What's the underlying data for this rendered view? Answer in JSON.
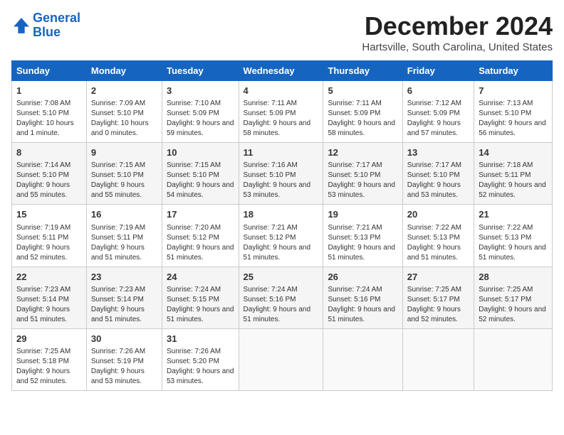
{
  "logo": {
    "line1": "General",
    "line2": "Blue"
  },
  "title": "December 2024",
  "subtitle": "Hartsville, South Carolina, United States",
  "days_of_week": [
    "Sunday",
    "Monday",
    "Tuesday",
    "Wednesday",
    "Thursday",
    "Friday",
    "Saturday"
  ],
  "weeks": [
    [
      {
        "day": "1",
        "sunrise": "7:08 AM",
        "sunset": "5:10 PM",
        "daylight": "10 hours and 1 minute."
      },
      {
        "day": "2",
        "sunrise": "7:09 AM",
        "sunset": "5:10 PM",
        "daylight": "10 hours and 0 minutes."
      },
      {
        "day": "3",
        "sunrise": "7:10 AM",
        "sunset": "5:09 PM",
        "daylight": "9 hours and 59 minutes."
      },
      {
        "day": "4",
        "sunrise": "7:11 AM",
        "sunset": "5:09 PM",
        "daylight": "9 hours and 58 minutes."
      },
      {
        "day": "5",
        "sunrise": "7:11 AM",
        "sunset": "5:09 PM",
        "daylight": "9 hours and 58 minutes."
      },
      {
        "day": "6",
        "sunrise": "7:12 AM",
        "sunset": "5:09 PM",
        "daylight": "9 hours and 57 minutes."
      },
      {
        "day": "7",
        "sunrise": "7:13 AM",
        "sunset": "5:10 PM",
        "daylight": "9 hours and 56 minutes."
      }
    ],
    [
      {
        "day": "8",
        "sunrise": "7:14 AM",
        "sunset": "5:10 PM",
        "daylight": "9 hours and 55 minutes."
      },
      {
        "day": "9",
        "sunrise": "7:15 AM",
        "sunset": "5:10 PM",
        "daylight": "9 hours and 55 minutes."
      },
      {
        "day": "10",
        "sunrise": "7:15 AM",
        "sunset": "5:10 PM",
        "daylight": "9 hours and 54 minutes."
      },
      {
        "day": "11",
        "sunrise": "7:16 AM",
        "sunset": "5:10 PM",
        "daylight": "9 hours and 53 minutes."
      },
      {
        "day": "12",
        "sunrise": "7:17 AM",
        "sunset": "5:10 PM",
        "daylight": "9 hours and 53 minutes."
      },
      {
        "day": "13",
        "sunrise": "7:17 AM",
        "sunset": "5:10 PM",
        "daylight": "9 hours and 53 minutes."
      },
      {
        "day": "14",
        "sunrise": "7:18 AM",
        "sunset": "5:11 PM",
        "daylight": "9 hours and 52 minutes."
      }
    ],
    [
      {
        "day": "15",
        "sunrise": "7:19 AM",
        "sunset": "5:11 PM",
        "daylight": "9 hours and 52 minutes."
      },
      {
        "day": "16",
        "sunrise": "7:19 AM",
        "sunset": "5:11 PM",
        "daylight": "9 hours and 51 minutes."
      },
      {
        "day": "17",
        "sunrise": "7:20 AM",
        "sunset": "5:12 PM",
        "daylight": "9 hours and 51 minutes."
      },
      {
        "day": "18",
        "sunrise": "7:21 AM",
        "sunset": "5:12 PM",
        "daylight": "9 hours and 51 minutes."
      },
      {
        "day": "19",
        "sunrise": "7:21 AM",
        "sunset": "5:13 PM",
        "daylight": "9 hours and 51 minutes."
      },
      {
        "day": "20",
        "sunrise": "7:22 AM",
        "sunset": "5:13 PM",
        "daylight": "9 hours and 51 minutes."
      },
      {
        "day": "21",
        "sunrise": "7:22 AM",
        "sunset": "5:13 PM",
        "daylight": "9 hours and 51 minutes."
      }
    ],
    [
      {
        "day": "22",
        "sunrise": "7:23 AM",
        "sunset": "5:14 PM",
        "daylight": "9 hours and 51 minutes."
      },
      {
        "day": "23",
        "sunrise": "7:23 AM",
        "sunset": "5:14 PM",
        "daylight": "9 hours and 51 minutes."
      },
      {
        "day": "24",
        "sunrise": "7:24 AM",
        "sunset": "5:15 PM",
        "daylight": "9 hours and 51 minutes."
      },
      {
        "day": "25",
        "sunrise": "7:24 AM",
        "sunset": "5:16 PM",
        "daylight": "9 hours and 51 minutes."
      },
      {
        "day": "26",
        "sunrise": "7:24 AM",
        "sunset": "5:16 PM",
        "daylight": "9 hours and 51 minutes."
      },
      {
        "day": "27",
        "sunrise": "7:25 AM",
        "sunset": "5:17 PM",
        "daylight": "9 hours and 52 minutes."
      },
      {
        "day": "28",
        "sunrise": "7:25 AM",
        "sunset": "5:17 PM",
        "daylight": "9 hours and 52 minutes."
      }
    ],
    [
      {
        "day": "29",
        "sunrise": "7:25 AM",
        "sunset": "5:18 PM",
        "daylight": "9 hours and 52 minutes."
      },
      {
        "day": "30",
        "sunrise": "7:26 AM",
        "sunset": "5:19 PM",
        "daylight": "9 hours and 53 minutes."
      },
      {
        "day": "31",
        "sunrise": "7:26 AM",
        "sunset": "5:20 PM",
        "daylight": "9 hours and 53 minutes."
      },
      null,
      null,
      null,
      null
    ]
  ]
}
